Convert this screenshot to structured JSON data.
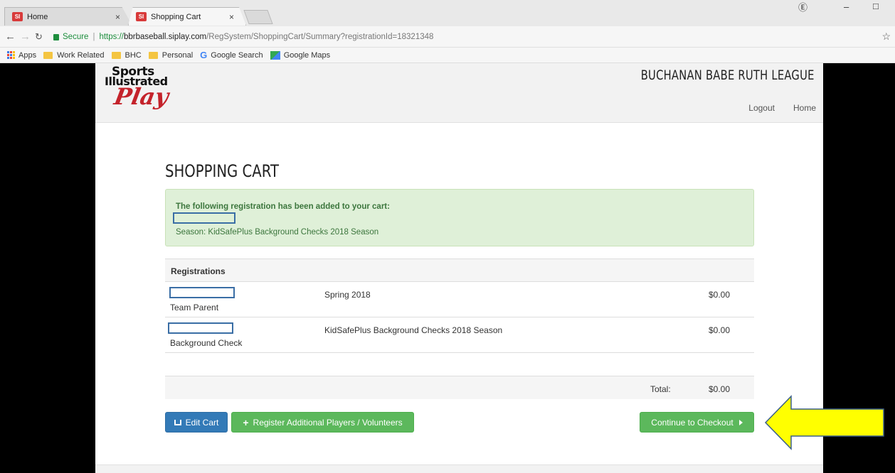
{
  "browser": {
    "tabs": [
      {
        "title": "Home",
        "active": false
      },
      {
        "title": "Shopping Cart",
        "active": true
      }
    ],
    "close_glyph": "×",
    "secure_label": "Secure",
    "url_proto": "https://",
    "url_host": "bbrbaseball.siplay.com",
    "url_path": "/RegSystem/ShoppingCart/Summary?registrationId=18321348",
    "bookmarks": [
      "Apps",
      "Work Related",
      "BHC",
      "Personal",
      "Google Search",
      "Google Maps"
    ]
  },
  "header": {
    "logo_sports": "Sports",
    "logo_illustrated": "Illustrated",
    "logo_play": "Play",
    "league_name": "BUCHANAN BABE RUTH LEAGUE",
    "nav": [
      "Logout",
      "Home"
    ]
  },
  "main": {
    "title": "SHOPPING CART",
    "alert": {
      "message": "The following registration has been added to your cart:",
      "season": "Season: KidSafePlus Background Checks 2018 Season"
    },
    "table": {
      "header": "Registrations",
      "rows": [
        {
          "role": "Team Parent",
          "season": "Spring 2018",
          "price": "$0.00"
        },
        {
          "role": "Background Check",
          "season": "KidSafePlus Background Checks 2018 Season",
          "price": "$0.00"
        }
      ],
      "total_label": "Total:",
      "total_value": "$0.00"
    },
    "buttons": {
      "edit_cart": "Edit Cart",
      "register_more": "Register Additional Players / Volunteers",
      "checkout": "Continue to Checkout"
    }
  },
  "colors": {
    "primary": "#337ab7",
    "success": "#5cb85c",
    "alert_bg": "#dff0d8",
    "annotation_arrow": "#ffff00"
  }
}
